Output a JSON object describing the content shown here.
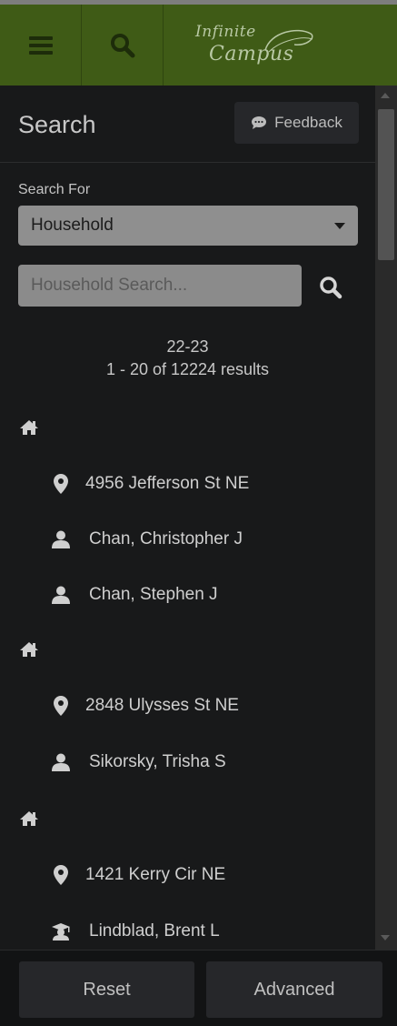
{
  "header": {
    "logo_line1": "Infinite",
    "logo_line2": "Campus"
  },
  "panel": {
    "title": "Search",
    "feedback_label": "Feedback",
    "search_for_label": "Search For",
    "search_type_selected": "Household",
    "search_placeholder": "Household Search...",
    "school_year": "22-23",
    "results_summary": "1 - 20 of 12224 results"
  },
  "results": {
    "h1": {
      "address": "4956 Jefferson St NE",
      "p1": "Chan, Christopher J",
      "p2": "Chan, Stephen J"
    },
    "h2": {
      "address": "2848 Ulysses St NE",
      "p1": "Sikorsky, Trisha S"
    },
    "h3": {
      "address": "1421 Kerry Cir NE",
      "p1": "Lindblad, Brent L"
    }
  },
  "footer": {
    "reset_label": "Reset",
    "advanced_label": "Advanced"
  },
  "icons": {
    "menu": "hamburger-icon",
    "search": "search-icon",
    "feedback": "speech-bubble-icon",
    "household": "home-icon",
    "address": "map-marker-icon",
    "person": "user-icon",
    "student": "graduation-cap-icon"
  },
  "colors": {
    "header_bg": "#3f5b16",
    "panel_bg": "#18191a",
    "accent_icon": "#1d2c0a"
  }
}
